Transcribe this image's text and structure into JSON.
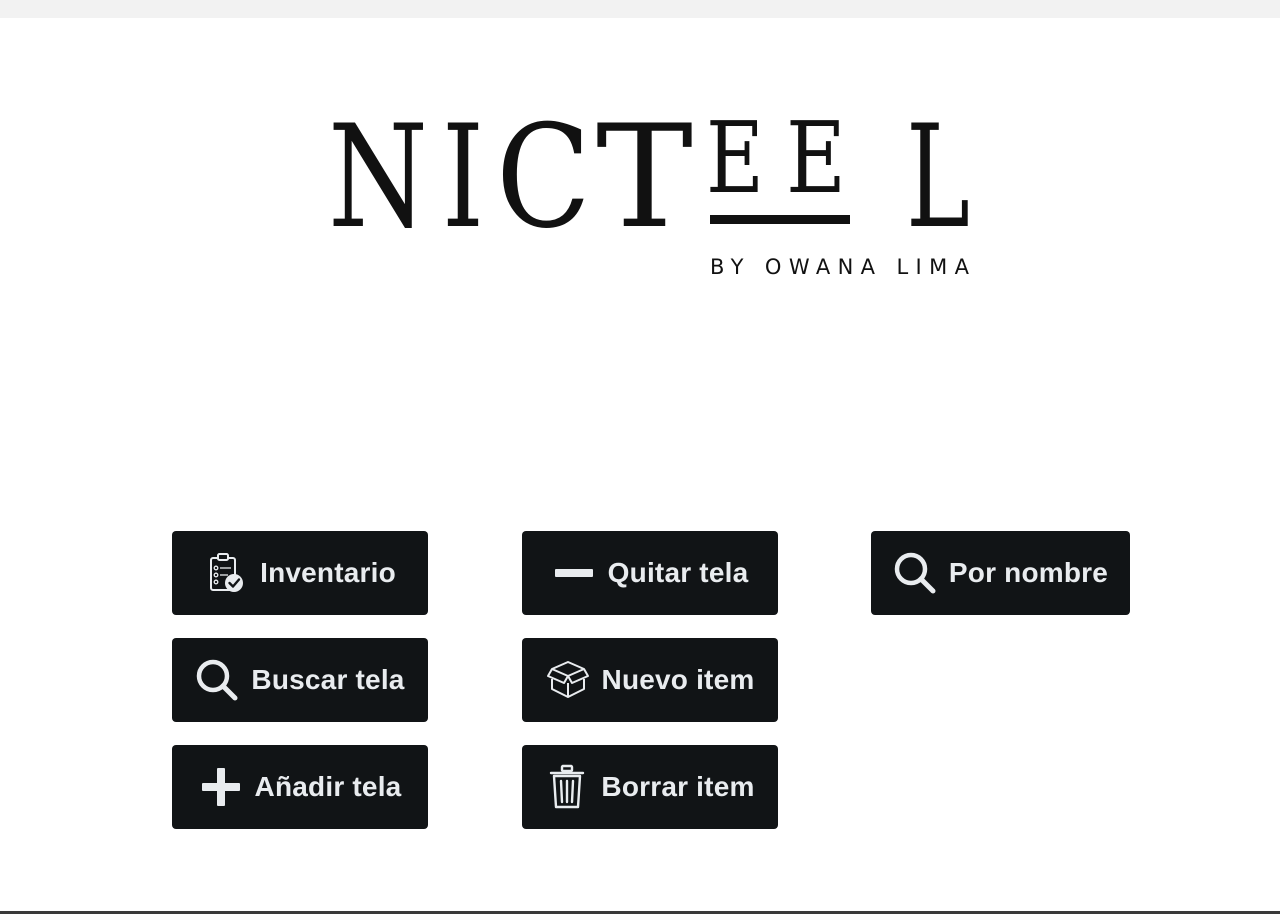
{
  "logo": {
    "letters": [
      "N",
      "I",
      "C",
      "T",
      "E",
      "E",
      "L"
    ],
    "tagline": "BY OWANA LIMA"
  },
  "buttons": [
    {
      "label": "Inventario",
      "icon": "clipboard-check-icon"
    },
    {
      "label": "Quitar tela",
      "icon": "minus-icon"
    },
    {
      "label": "Por nombre",
      "icon": "search-icon"
    },
    {
      "label": "Buscar tela",
      "icon": "search-icon"
    },
    {
      "label": "Nuevo item",
      "icon": "box-icon"
    },
    {
      "label": "Añadir tela",
      "icon": "plus-icon"
    },
    {
      "label": "Borrar item",
      "icon": "trash-icon"
    }
  ],
  "colors": {
    "button_bg": "#111416",
    "button_text": "#e9ecef",
    "logo": "#111111"
  }
}
